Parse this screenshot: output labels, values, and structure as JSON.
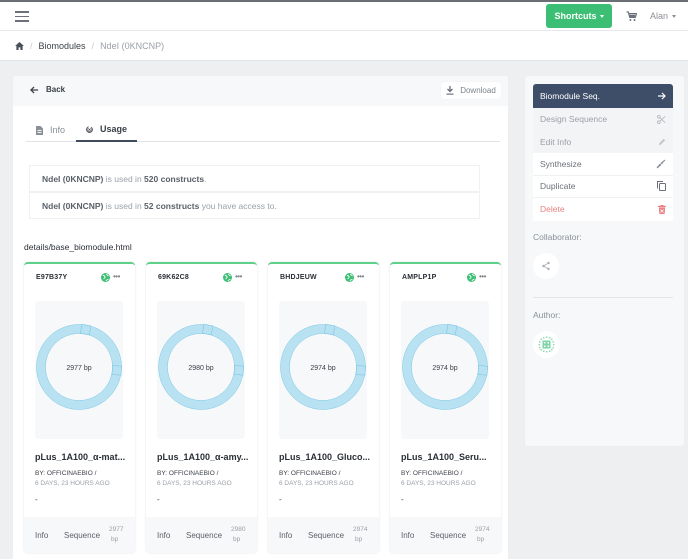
{
  "topbar": {
    "shortcuts_label": "Shortcuts",
    "user_name": "Alan",
    "colors": {
      "shortcuts": "#3cbf74"
    }
  },
  "breadcrumb": {
    "items": [
      "Biomodules"
    ],
    "current": "NdeI (0KNCNP)"
  },
  "main": {
    "back_label": "Back",
    "download_label": "Download",
    "tabs": [
      {
        "label": "Info",
        "active": false
      },
      {
        "label": "Usage",
        "active": true
      }
    ],
    "usage": [
      {
        "name": "NdeI (0KNCNP)",
        "pre": " is used in ",
        "count": "520 constructs",
        "post": "."
      },
      {
        "name": "NdeI (0KNCNP)",
        "pre": " is used in ",
        "count": "52 constructs",
        "post": " you have access to."
      }
    ],
    "template_path": "details/base_biomodule.html",
    "constructs": [
      {
        "id": "E97B37Y",
        "size": "2977 bp",
        "title": "pLus_1A100_α-mat...",
        "by": "BY: OFFICINAEBIO /",
        "time": "6 DAYS, 23 HOURS AGO",
        "desc": "-",
        "info": "Info",
        "sequence": "Sequence",
        "bp_num": "2977",
        "bp_unit": "bp",
        "visibility": "public"
      },
      {
        "id": "69K62C8",
        "size": "2980 bp",
        "title": "pLus_1A100_α-amy...",
        "by": "BY: OFFICINAEBIO /",
        "time": "6 DAYS, 23 HOURS AGO",
        "desc": "-",
        "info": "Info",
        "sequence": "Sequence",
        "bp_num": "2980",
        "bp_unit": "bp",
        "visibility": "public"
      },
      {
        "id": "BHDJEUW",
        "size": "2974 bp",
        "title": "pLus_1A100_Gluco...",
        "by": "BY: OFFICINAEBIO /",
        "time": "6 DAYS, 23 HOURS AGO",
        "desc": "-",
        "info": "Info",
        "sequence": "Sequence",
        "bp_num": "2974",
        "bp_unit": "bp",
        "visibility": "public"
      },
      {
        "id": "AMPLP1P",
        "size": "2974 bp",
        "title": "pLus_1A100_Seru...",
        "by": "BY: OFFICINAEBIO /",
        "time": "6 DAYS, 23 HOURS AGO",
        "desc": "-",
        "info": "Info",
        "sequence": "Sequence",
        "bp_num": "2974",
        "bp_unit": "bp",
        "visibility": "public"
      }
    ]
  },
  "sidebar": {
    "menu": [
      {
        "label": "Biomodule Seq.",
        "icon": "arrow-right-icon",
        "style": "primary"
      },
      {
        "label": "Design Sequence",
        "icon": "scissors-icon",
        "style": "muted"
      },
      {
        "label": "Edit Info",
        "icon": "pencil-icon",
        "style": "muted"
      },
      {
        "label": "Synthesize",
        "icon": "dna-icon",
        "style": "normal"
      },
      {
        "label": "Duplicate",
        "icon": "copy-icon",
        "style": "normal"
      },
      {
        "label": "Delete",
        "icon": "trash-icon",
        "style": "danger"
      }
    ],
    "collaborator_label": "Collaborator:",
    "author_label": "Author:"
  },
  "colors": {
    "primary": "#3e4d68",
    "success": "#3cbf74",
    "danger": "#e98282",
    "plasmid": "#b8e2f2",
    "plasmid_stroke": "#7cc6e4"
  }
}
